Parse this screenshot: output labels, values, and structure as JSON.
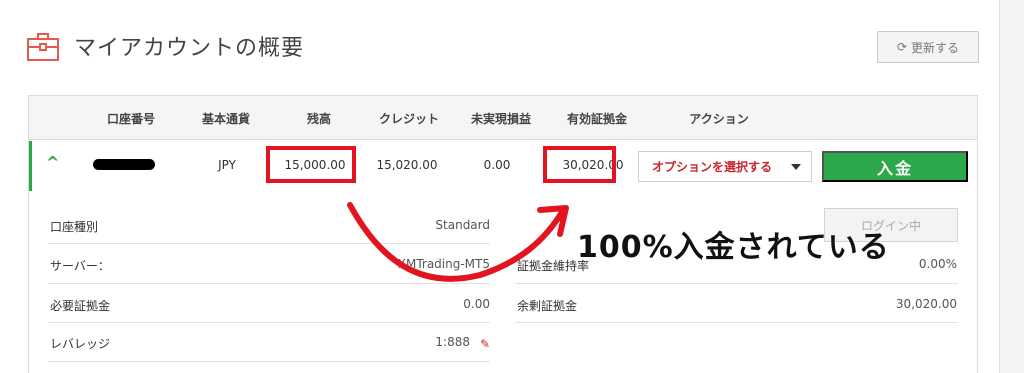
{
  "header": {
    "title": "マイアカウントの概要",
    "refresh_label": "更新する"
  },
  "table": {
    "columns": [
      "口座番号",
      "基本通貨",
      "残高",
      "クレジット",
      "未実現損益",
      "有効証拠金",
      "アクション"
    ],
    "row": {
      "currency": "JPY",
      "balance": "15,000.00",
      "credit": "15,020.00",
      "unrealized_pl": "0.00",
      "equity": "30,020.00",
      "action_select": "オプションを選択する",
      "deposit_label": "入金"
    }
  },
  "details": {
    "account_type_label": "口座種別",
    "account_type_value": "Standard",
    "server_label": "サーバー：",
    "server_value": "XMTrading-MT5",
    "required_margin_label": "必要証拠金",
    "required_margin_value": "0.00",
    "leverage_label": "レバレッジ",
    "leverage_value": "1:888",
    "margin_level_label": "証拠金維持率",
    "margin_level_value": "0.00%",
    "free_margin_label": "余剰証拠金",
    "free_margin_value": "30,020.00",
    "login_label": "ログイン中"
  },
  "annotation": {
    "text": "100%入金されている"
  },
  "colors": {
    "accent_green": "#2ba84a",
    "highlight_red": "#e2141f",
    "action_red": "#c9252c"
  },
  "icons": {
    "header": "briefcase-icon",
    "refresh": "refresh-icon",
    "expand": "chevron-up-icon",
    "edit": "pencil-icon"
  }
}
